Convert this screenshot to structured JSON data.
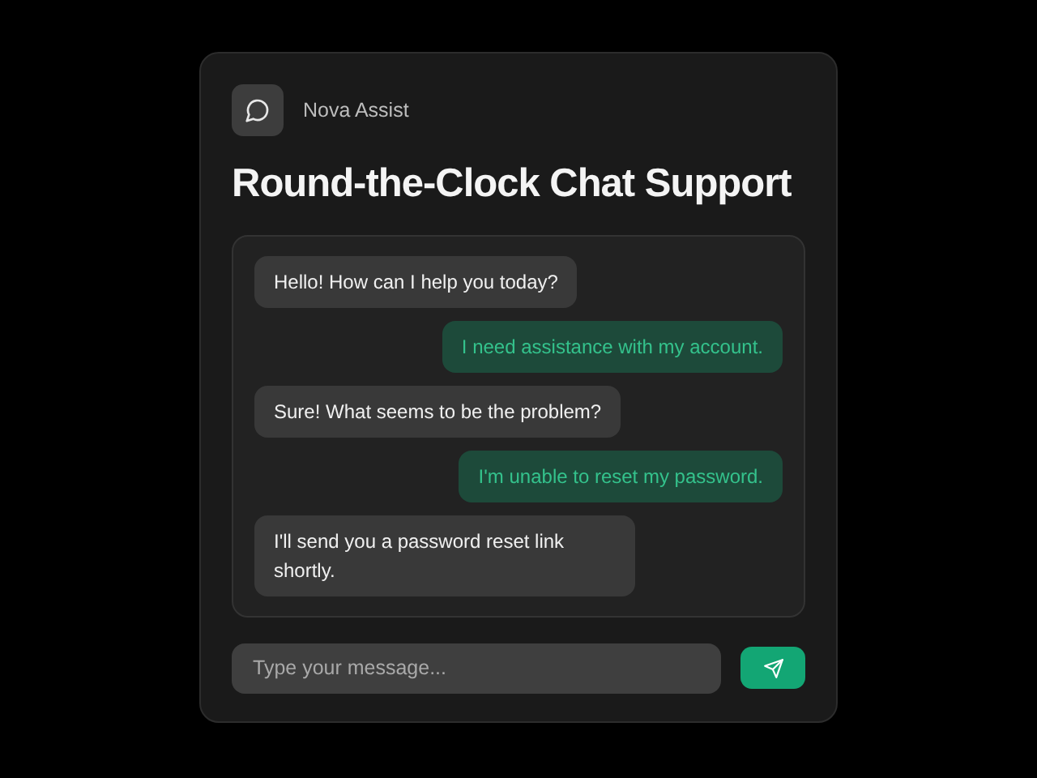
{
  "brand": {
    "name": "Nova Assist"
  },
  "title": "Round-the-Clock Chat Support",
  "messages": [
    {
      "kind": "bot",
      "text": "Hello! How can I help you today?"
    },
    {
      "kind": "user",
      "text": "I need assistance with my account."
    },
    {
      "kind": "bot",
      "text": "Sure! What seems to be the problem?"
    },
    {
      "kind": "user",
      "text": "I'm unable to reset my password."
    },
    {
      "kind": "bot",
      "text": "I'll send you a password reset link shortly."
    }
  ],
  "composer": {
    "placeholder": "Type your message..."
  }
}
